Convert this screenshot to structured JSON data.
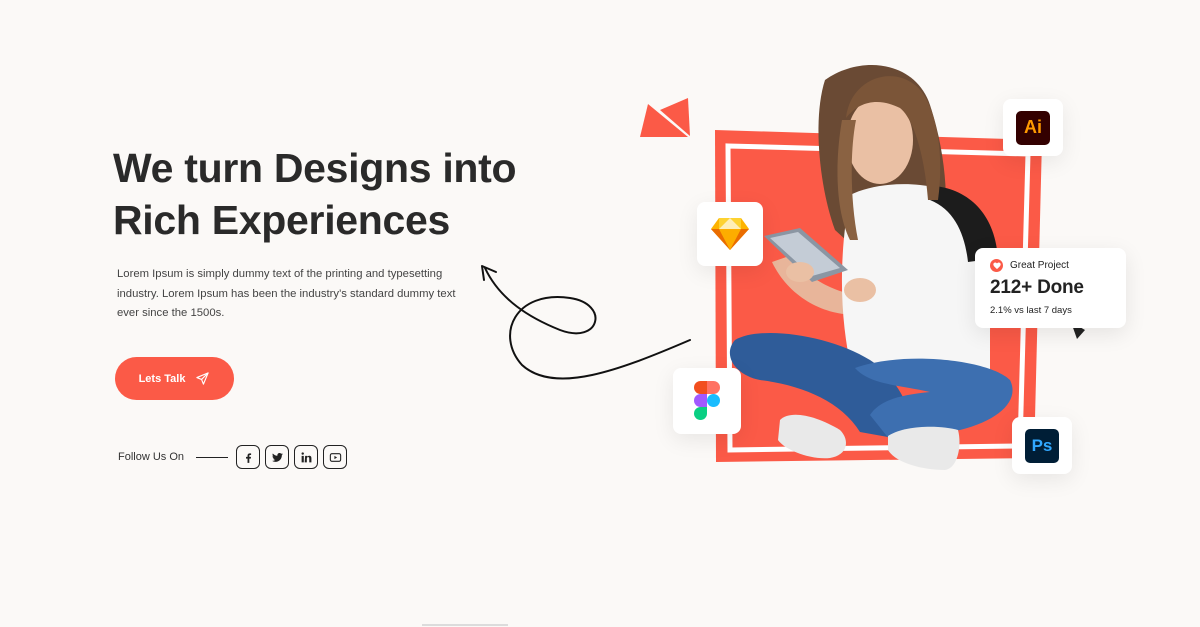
{
  "hero": {
    "title_line1": "We turn Designs into",
    "title_line2": "Rich Experiences",
    "description": "Lorem Ipsum is simply dummy text of the printing and typesetting industry. Lorem Ipsum has been the industry's standard dummy text ever since the 1500s.",
    "cta_label": "Lets Talk",
    "cta_icon": "send-icon"
  },
  "social": {
    "label": "Follow Us On",
    "links": [
      {
        "name": "facebook",
        "icon": "facebook-icon"
      },
      {
        "name": "twitter",
        "icon": "twitter-icon"
      },
      {
        "name": "linkedin",
        "icon": "linkedin-icon"
      },
      {
        "name": "youtube",
        "icon": "youtube-icon"
      }
    ]
  },
  "stat_card": {
    "label": "Great Project",
    "value": "212+ Done",
    "sub": "2.1% vs last 7 days"
  },
  "app_icons": {
    "illustrator": "Ai",
    "photoshop": "Ps",
    "sketch": "sketch-icon",
    "figma": "figma-icon"
  },
  "colors": {
    "accent": "#fb5a47",
    "background": "#fbf9f7",
    "text": "#2a2a2a",
    "illustrator_bg": "#330000",
    "illustrator_fg": "#ff9a00",
    "photoshop_bg": "#001e36",
    "photoshop_fg": "#31a8ff"
  }
}
